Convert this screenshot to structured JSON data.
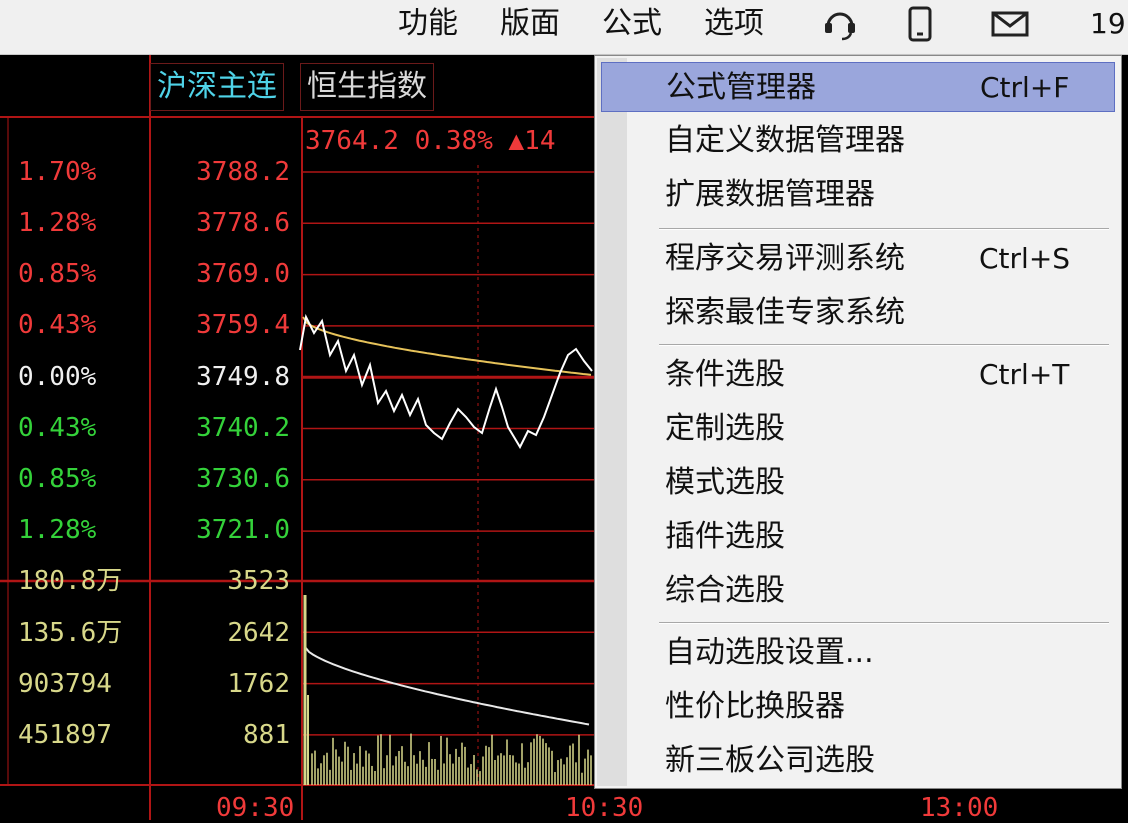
{
  "menubar": {
    "items": [
      "功能",
      "版面",
      "公式",
      "选项"
    ],
    "icons": [
      "headset-icon",
      "phone-icon",
      "mail-icon"
    ],
    "clock": "19"
  },
  "chart": {
    "tabs": [
      {
        "label": "沪深主连",
        "active": true
      },
      {
        "label": "恒生指数",
        "active": false
      }
    ],
    "header_quote": {
      "price": "3764.2",
      "change_pct": "0.38%",
      "arrow": "▲",
      "change": "14"
    },
    "price_axis": [
      {
        "pct": "1.70%",
        "price": "3788.2",
        "color": "red"
      },
      {
        "pct": "1.28%",
        "price": "3778.6",
        "color": "red"
      },
      {
        "pct": "0.85%",
        "price": "3769.0",
        "color": "red"
      },
      {
        "pct": "0.43%",
        "price": "3759.4",
        "color": "red"
      },
      {
        "pct": "0.00%",
        "price": "3749.8",
        "color": "white"
      },
      {
        "pct": "0.43%",
        "price": "3740.2",
        "color": "green"
      },
      {
        "pct": "0.85%",
        "price": "3730.6",
        "color": "green"
      },
      {
        "pct": "1.28%",
        "price": "3721.0",
        "color": "green"
      }
    ],
    "volume_axis": [
      {
        "left": "180.8万",
        "right": "3523"
      },
      {
        "left": "135.6万",
        "right": "2642"
      },
      {
        "left": "903794",
        "right": "1762"
      },
      {
        "left": "451897",
        "right": "881"
      }
    ],
    "time_axis": [
      "09:30",
      "10:30",
      "13:00"
    ],
    "colors": {
      "background": "#000000",
      "grid": "#b01515",
      "price_line": "#ffffff",
      "avg_line": "#e6c25a",
      "volume_bar": "#d8d88a"
    }
  },
  "dropdown": {
    "groups": [
      [
        {
          "label": "公式管理器",
          "shortcut": "Ctrl+F",
          "active": true
        },
        {
          "label": "自定义数据管理器",
          "shortcut": ""
        },
        {
          "label": "扩展数据管理器",
          "shortcut": ""
        }
      ],
      [
        {
          "label": "程序交易评测系统",
          "shortcut": "Ctrl+S"
        },
        {
          "label": "探索最佳专家系统",
          "shortcut": ""
        }
      ],
      [
        {
          "label": "条件选股",
          "shortcut": "Ctrl+T"
        },
        {
          "label": "定制选股",
          "shortcut": ""
        },
        {
          "label": "模式选股",
          "shortcut": ""
        },
        {
          "label": "插件选股",
          "shortcut": ""
        },
        {
          "label": "综合选股",
          "shortcut": ""
        }
      ],
      [
        {
          "label": "自动选股设置...",
          "shortcut": ""
        },
        {
          "label": "性价比换股器",
          "shortcut": ""
        },
        {
          "label": "新三板公司选股",
          "shortcut": ""
        }
      ]
    ]
  }
}
